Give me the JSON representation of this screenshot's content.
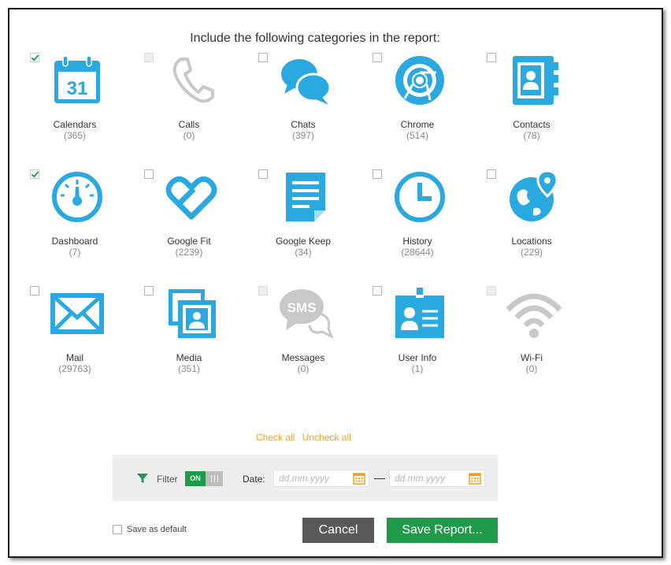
{
  "heading": "Include the following categories in the report:",
  "accent_color": "#2aa8e0",
  "disabled_color": "#c8c8c8",
  "categories": [
    {
      "name": "Calendars",
      "count": "(365)",
      "checked": true,
      "enabled": true,
      "icon": "calendar-icon"
    },
    {
      "name": "Calls",
      "count": "(0)",
      "checked": false,
      "enabled": false,
      "icon": "phone-icon"
    },
    {
      "name": "Chats",
      "count": "(397)",
      "checked": false,
      "enabled": true,
      "icon": "chat-bubbles-icon"
    },
    {
      "name": "Chrome",
      "count": "(514)",
      "checked": false,
      "enabled": true,
      "icon": "chrome-icon"
    },
    {
      "name": "Contacts",
      "count": "(78)",
      "checked": false,
      "enabled": true,
      "icon": "contacts-book-icon"
    },
    {
      "name": "Dashboard",
      "count": "(7)",
      "checked": true,
      "enabled": true,
      "icon": "gauge-icon"
    },
    {
      "name": "Google Fit",
      "count": "(2239)",
      "checked": false,
      "enabled": true,
      "icon": "heart-icon"
    },
    {
      "name": "Google Keep",
      "count": "(34)",
      "checked": false,
      "enabled": true,
      "icon": "note-icon"
    },
    {
      "name": "History",
      "count": "(28644)",
      "checked": false,
      "enabled": true,
      "icon": "clock-icon"
    },
    {
      "name": "Locations",
      "count": "(229)",
      "checked": false,
      "enabled": true,
      "icon": "globe-pin-icon"
    },
    {
      "name": "Mail",
      "count": "(29763)",
      "checked": false,
      "enabled": true,
      "icon": "envelope-icon"
    },
    {
      "name": "Media",
      "count": "(351)",
      "checked": false,
      "enabled": true,
      "icon": "photos-icon"
    },
    {
      "name": "Messages",
      "count": "(0)",
      "checked": false,
      "enabled": false,
      "icon": "sms-icon"
    },
    {
      "name": "User Info",
      "count": "(1)",
      "checked": false,
      "enabled": true,
      "icon": "id-badge-icon"
    },
    {
      "name": "Wi-Fi",
      "count": "(0)",
      "checked": false,
      "enabled": false,
      "icon": "wifi-icon"
    }
  ],
  "links": {
    "check_all": "Check all",
    "uncheck_all": "Uncheck all"
  },
  "filter": {
    "label": "Filter",
    "toggle_state": "ON",
    "date_label": "Date:",
    "date_from_placeholder": "dd.mm.yyyy",
    "date_to_placeholder": "dd.mm.yyyy"
  },
  "save_as_default": "Save as default",
  "buttons": {
    "cancel": "Cancel",
    "save": "Save Report..."
  }
}
